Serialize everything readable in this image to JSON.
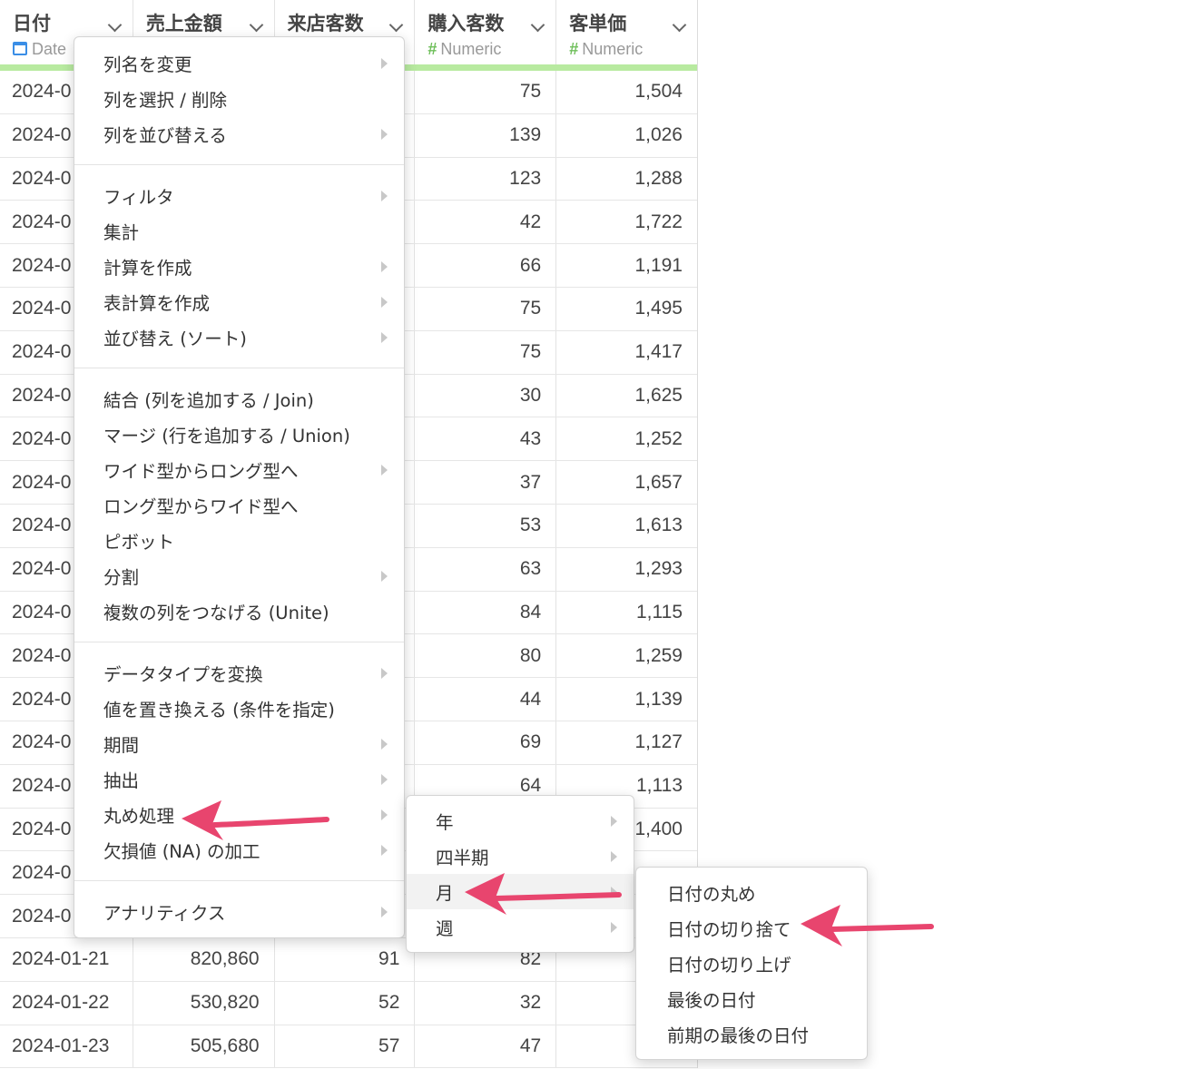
{
  "table": {
    "columns": [
      {
        "name": "日付",
        "type_label": "Date",
        "type_icon": "calendar-icon"
      },
      {
        "name": "売上金額",
        "type_label": "",
        "type_icon": ""
      },
      {
        "name": "来店客数",
        "type_label": "",
        "type_icon": ""
      },
      {
        "name": "購入客数",
        "type_label": "Numeric",
        "type_icon": "hash-icon"
      },
      {
        "name": "客単価",
        "type_label": "Numeric",
        "type_icon": "hash-icon"
      }
    ],
    "header_accent_color": "#b8eaa0",
    "rows": [
      [
        "2024-0",
        "",
        "",
        "75",
        "1,504"
      ],
      [
        "2024-0",
        "",
        "",
        "139",
        "1,026"
      ],
      [
        "2024-0",
        "",
        "",
        "123",
        "1,288"
      ],
      [
        "2024-0",
        "",
        "",
        "42",
        "1,722"
      ],
      [
        "2024-0",
        "",
        "",
        "66",
        "1,191"
      ],
      [
        "2024-0",
        "",
        "",
        "75",
        "1,495"
      ],
      [
        "2024-0",
        "",
        "",
        "75",
        "1,417"
      ],
      [
        "2024-0",
        "",
        "",
        "30",
        "1,625"
      ],
      [
        "2024-0",
        "",
        "",
        "43",
        "1,252"
      ],
      [
        "2024-0",
        "",
        "",
        "37",
        "1,657"
      ],
      [
        "2024-0",
        "",
        "",
        "53",
        "1,613"
      ],
      [
        "2024-0",
        "",
        "",
        "63",
        "1,293"
      ],
      [
        "2024-0",
        "",
        "",
        "84",
        "1,115"
      ],
      [
        "2024-0",
        "",
        "",
        "80",
        "1,259"
      ],
      [
        "2024-0",
        "",
        "",
        "44",
        "1,139"
      ],
      [
        "2024-0",
        "",
        "",
        "69",
        "1,127"
      ],
      [
        "2024-0",
        "",
        "",
        "64",
        "1,113"
      ],
      [
        "2024-0",
        "",
        "",
        "",
        "1,400"
      ],
      [
        "2024-0",
        "",
        "",
        "",
        ""
      ],
      [
        "2024-0",
        "",
        "",
        "",
        ""
      ],
      [
        "2024-01-21",
        "820,860",
        "91",
        "82",
        ""
      ],
      [
        "2024-01-22",
        "530,820",
        "52",
        "32",
        ""
      ],
      [
        "2024-01-23",
        "505,680",
        "57",
        "47",
        ""
      ]
    ]
  },
  "context_menu": {
    "groups": [
      [
        {
          "label": "列名を変更",
          "submenu": true
        },
        {
          "label": "列を選択 / 削除",
          "submenu": false
        },
        {
          "label": "列を並び替える",
          "submenu": true
        }
      ],
      [
        {
          "label": "フィルタ",
          "submenu": true
        },
        {
          "label": "集計",
          "submenu": false
        },
        {
          "label": "計算を作成",
          "submenu": true
        },
        {
          "label": "表計算を作成",
          "submenu": true
        },
        {
          "label": "並び替え (ソート)",
          "submenu": true
        }
      ],
      [
        {
          "label": "結合 (列を追加する / Join)",
          "submenu": false
        },
        {
          "label": "マージ (行を追加する / Union)",
          "submenu": false
        },
        {
          "label": "ワイド型からロング型へ",
          "submenu": true
        },
        {
          "label": "ロング型からワイド型へ",
          "submenu": false
        },
        {
          "label": "ピボット",
          "submenu": false
        },
        {
          "label": "分割",
          "submenu": true
        },
        {
          "label": "複数の列をつなげる (Unite)",
          "submenu": false
        }
      ],
      [
        {
          "label": "データタイプを変換",
          "submenu": true
        },
        {
          "label": "値を置き換える (条件を指定)",
          "submenu": false
        },
        {
          "label": "期間",
          "submenu": true
        },
        {
          "label": "抽出",
          "submenu": true
        },
        {
          "label": "丸め処理",
          "submenu": true
        },
        {
          "label": "欠損値 (NA) の加工",
          "submenu": true
        }
      ],
      [
        {
          "label": "アナリティクス",
          "submenu": true
        }
      ]
    ]
  },
  "rounding_submenu": {
    "items": [
      {
        "label": "年",
        "submenu": true
      },
      {
        "label": "四半期",
        "submenu": true
      },
      {
        "label": "月",
        "submenu": true
      },
      {
        "label": "週",
        "submenu": true
      }
    ]
  },
  "month_submenu": {
    "items": [
      {
        "label": "日付の丸め"
      },
      {
        "label": "日付の切り捨て"
      },
      {
        "label": "日付の切り上げ"
      },
      {
        "label": "最後の日付"
      },
      {
        "label": "前期の最後の日付"
      }
    ]
  },
  "annotation_color": "#e8456e"
}
